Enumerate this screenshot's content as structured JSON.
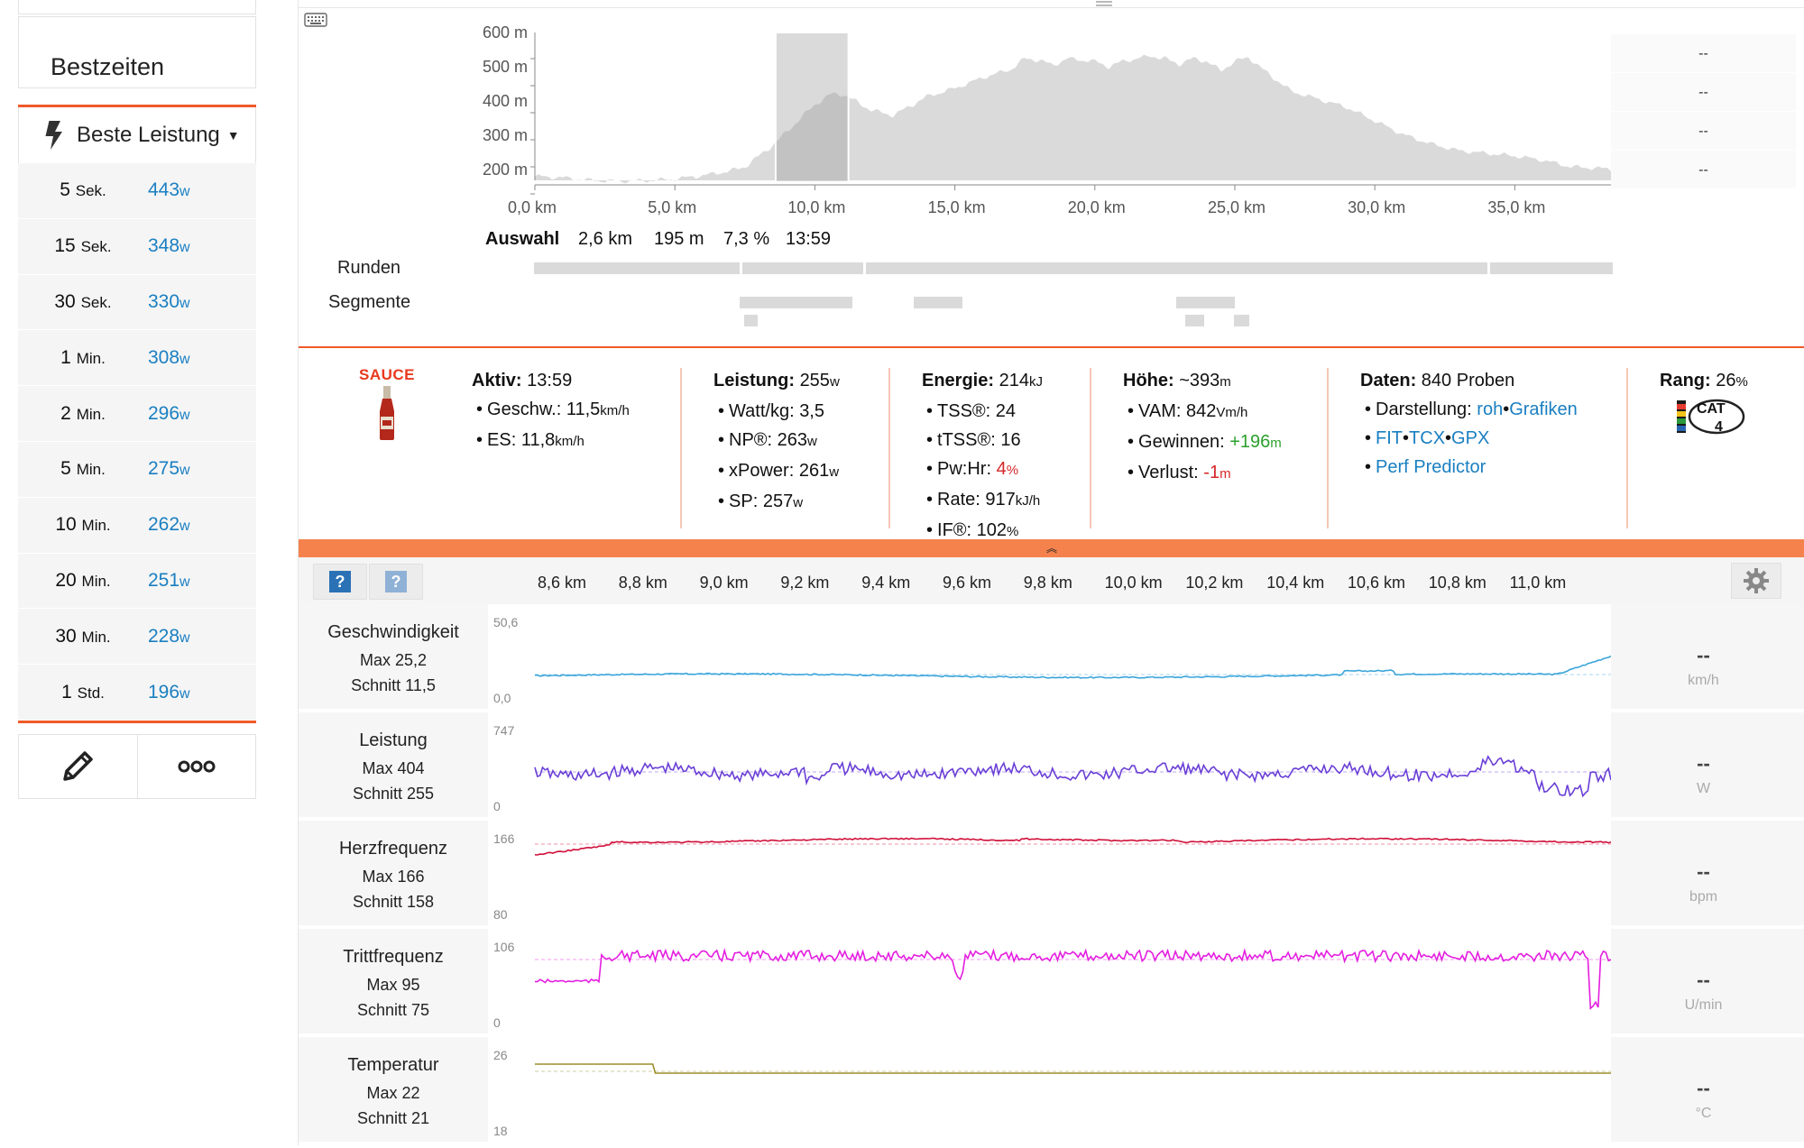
{
  "sidebar": {
    "bestzeiten": "Bestzeiten",
    "beste_leistung": "Beste Leistung",
    "rows": [
      {
        "n": "5",
        "u": "Sek.",
        "w": "443",
        "wu": "w"
      },
      {
        "n": "15",
        "u": "Sek.",
        "w": "348",
        "wu": "w"
      },
      {
        "n": "30",
        "u": "Sek.",
        "w": "330",
        "wu": "w"
      },
      {
        "n": "1",
        "u": "Min.",
        "w": "308",
        "wu": "w"
      },
      {
        "n": "2",
        "u": "Min.",
        "w": "296",
        "wu": "w"
      },
      {
        "n": "5",
        "u": "Min.",
        "w": "275",
        "wu": "w"
      },
      {
        "n": "10",
        "u": "Min.",
        "w": "262",
        "wu": "w"
      },
      {
        "n": "20",
        "u": "Min.",
        "w": "251",
        "wu": "w"
      },
      {
        "n": "30",
        "u": "Min.",
        "w": "228",
        "wu": "w"
      },
      {
        "n": "1",
        "u": "Std.",
        "w": "196",
        "wu": "w"
      }
    ]
  },
  "elevation": {
    "y_labels": [
      "600 m",
      "500 m",
      "400 m",
      "300 m",
      "200 m"
    ],
    "x_labels": [
      "0,0 km",
      "5,0 km",
      "10,0 km",
      "15,0 km",
      "20,0 km",
      "25,0 km",
      "30,0 km",
      "35,0 km"
    ],
    "right_values": [
      "--",
      "--",
      "--",
      "--"
    ],
    "selection": {
      "label": "Auswahl",
      "distance": "2,6 km",
      "elevation": "195 m",
      "grade": "7,3 %",
      "time": "13:59"
    },
    "runden_label": "Runden",
    "segmente_label": "Segmente"
  },
  "stats": {
    "sauce_label": "SAUCE",
    "aktiv": {
      "label": "Aktiv:",
      "value": "13:59",
      "items": [
        {
          "k": "Geschw.:",
          "v": "11,5",
          "u": "km/h"
        },
        {
          "k": "ES:",
          "v": "11,8",
          "u": "km/h"
        }
      ]
    },
    "leistung": {
      "label": "Leistung:",
      "value": "255",
      "unit": "w",
      "items": [
        {
          "k": "Watt/kg:",
          "v": "3,5",
          "u": ""
        },
        {
          "k": "NP®:",
          "v": "263",
          "u": "w"
        },
        {
          "k": "xPower:",
          "v": "261",
          "u": "w"
        },
        {
          "k": "SP:",
          "v": "257",
          "u": "w"
        }
      ]
    },
    "energie": {
      "label": "Energie:",
      "value": "214",
      "unit": "kJ",
      "items": [
        {
          "k": "TSS®:",
          "v": "24",
          "u": ""
        },
        {
          "k": "tTSS®:",
          "v": "16",
          "u": ""
        },
        {
          "k": "Pw:Hr:",
          "v": "4",
          "u": "%"
        },
        {
          "k": "Rate:",
          "v": "917",
          "u": "kJ/h"
        },
        {
          "k": "IF®:",
          "v": "102",
          "u": "%"
        }
      ]
    },
    "hoehe": {
      "label": "Höhe:",
      "value": "~393",
      "unit": "m",
      "items": [
        {
          "k": "VAM:",
          "v": "842",
          "u": "Vm/h"
        },
        {
          "k": "Gewinnen:",
          "v": "+196",
          "u": "m"
        },
        {
          "k": "Verlust:",
          "v": "-1",
          "u": "m"
        }
      ]
    },
    "daten": {
      "label": "Daten:",
      "value": "840 Proben",
      "darstellung": "Darstellung:",
      "roh": "roh",
      "grafiken": "Grafiken",
      "fit": "FIT",
      "tcx": "TCX",
      "gpx": "GPX",
      "perf": "Perf Predictor"
    },
    "rang": {
      "label": "Rang:",
      "value": "26",
      "unit": "%",
      "cat": "CAT",
      "cat_num": "4"
    }
  },
  "streams": {
    "km_ticks": [
      "8,6 km",
      "8,8 km",
      "9,0 km",
      "9,2 km",
      "9,4 km",
      "9,6 km",
      "9,8 km",
      "10,0 km",
      "10,2 km",
      "10,4 km",
      "10,6 km",
      "10,8 km",
      "11,0 km"
    ],
    "rows": [
      {
        "name": "Geschwindigkeit",
        "max": "Max 25,2",
        "avg": "Schnitt 11,5",
        "ymax": "50,6",
        "ymin": "0,0",
        "dash": "--",
        "unit": "km/h",
        "color": "#3ba5db"
      },
      {
        "name": "Leistung",
        "max": "Max 404",
        "avg": "Schnitt 255",
        "ymax": "747",
        "ymin": "0",
        "dash": "--",
        "unit": "W",
        "color": "#6a3fd6"
      },
      {
        "name": "Herzfrequenz",
        "max": "Max 166",
        "avg": "Schnitt 158",
        "ymax": "166",
        "ymin": "80",
        "dash": "--",
        "unit": "bpm",
        "color": "#d0103a"
      },
      {
        "name": "Trittfrequenz",
        "max": "Max 95",
        "avg": "Schnitt 75",
        "ymax": "106",
        "ymin": "0",
        "dash": "--",
        "unit": "U/min",
        "color": "#e41ee0"
      },
      {
        "name": "Temperatur",
        "max": "Max 22",
        "avg": "Schnitt 21",
        "ymax": "26",
        "ymin": "18",
        "dash": "--",
        "unit": "°C",
        "color": "#9b8d2a"
      }
    ]
  }
}
